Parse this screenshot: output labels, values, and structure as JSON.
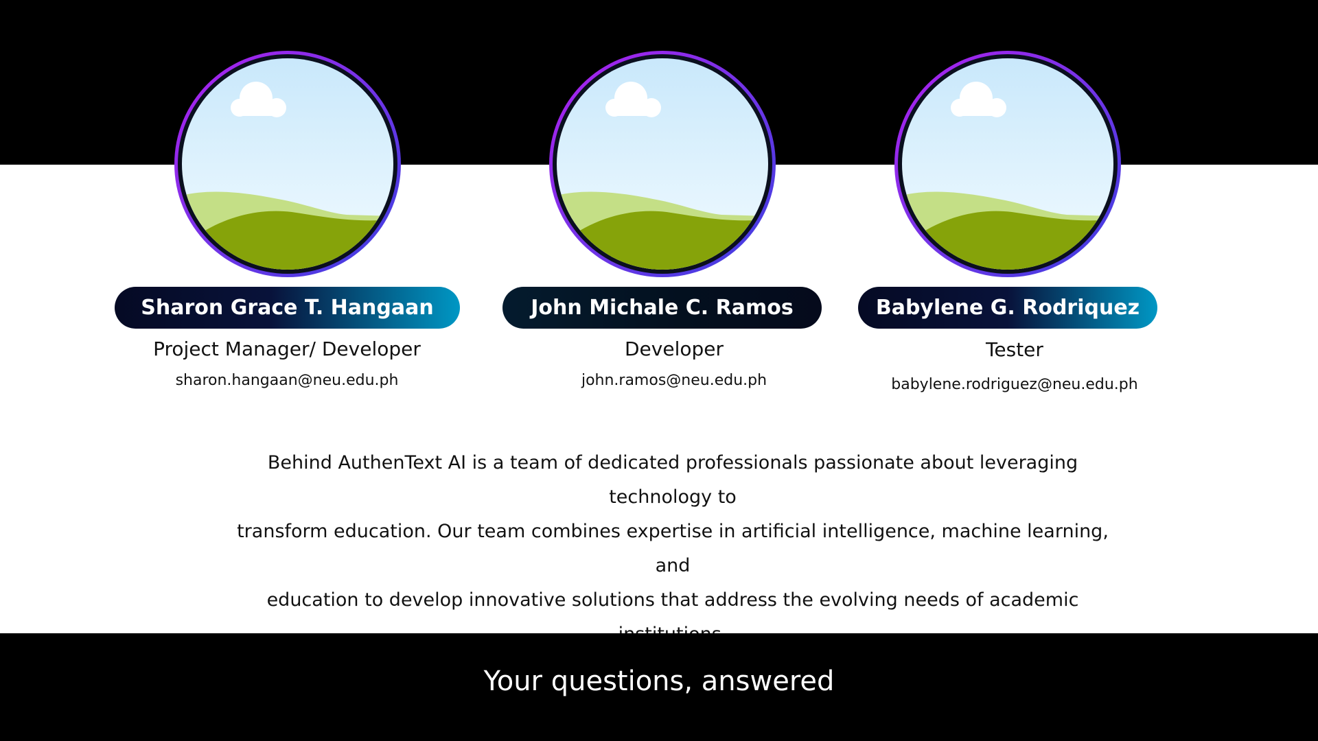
{
  "colors": {
    "band": "#000000",
    "background": "#ffffff",
    "pill_dark": "#050a24",
    "pill_accent": "#0097c4",
    "ring_start": "#b21ff0",
    "ring_end": "#3a3fe0"
  },
  "team": [
    {
      "name": "Sharon Grace T. Hangaan",
      "role": "Project Manager/ Developer",
      "email": "sharon.hangaan@neu.edu.ph",
      "avatar_icon": "landscape-placeholder-icon"
    },
    {
      "name": "John Michale C. Ramos",
      "role": "Developer",
      "email": "john.ramos@neu.edu.ph",
      "avatar_icon": "landscape-placeholder-icon"
    },
    {
      "name": "Babylene G. Rodriquez",
      "role": "Tester",
      "email": "babylene.rodriguez@neu.edu.ph",
      "avatar_icon": "landscape-placeholder-icon"
    }
  ],
  "description": {
    "line1": "Behind AuthenText AI is a team of dedicated professionals passionate about leveraging technology to",
    "line2": "transform education. Our team combines expertise in artificial intelligence, machine learning, and",
    "line3": "education to develop innovative solutions that address the evolving needs of academic institutions."
  },
  "footer": {
    "title": "Your questions, answered"
  }
}
